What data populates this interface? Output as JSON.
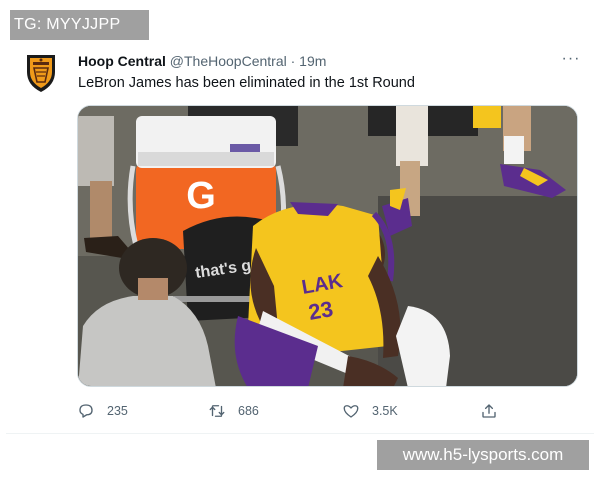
{
  "watermarks": {
    "top": "TG: MYYJJPP",
    "bottom": "www.h5-lysports.com"
  },
  "tweet": {
    "author_name": "Hoop Central",
    "handle": "@TheHoopCentral",
    "separator": "·",
    "time": "19m",
    "more_icon": "···",
    "text": "LeBron James has been eliminated in the 1st Round",
    "media": {
      "cooler_brand": "G",
      "chair_text": "that's g",
      "jersey_text": "LAK",
      "jersey_number": "23"
    },
    "actions": {
      "reply_count": "235",
      "retweet_count": "686",
      "like_count": "3.5K"
    }
  },
  "colors": {
    "icon_gray": "#536471",
    "text": "#0f1419",
    "lakers_gold": "#f4c51e",
    "lakers_purple": "#5b2d8e",
    "cooler_orange": "#f26722"
  },
  "icons": [
    "avatar-logo",
    "more-icon",
    "reply-icon",
    "retweet-icon",
    "like-icon",
    "share-icon"
  ]
}
